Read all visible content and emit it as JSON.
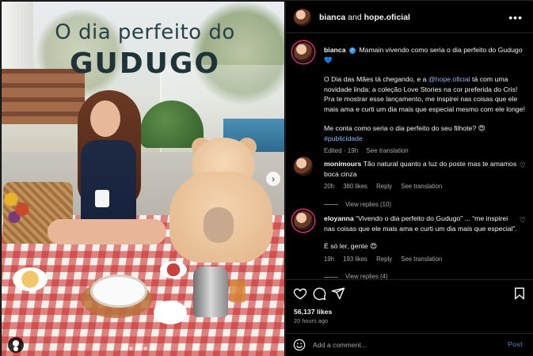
{
  "media": {
    "overlay_title_line1": "O dia perfeito do",
    "overlay_title_line2": "GUDUGO",
    "carousel_dots": 5,
    "active_dot": 0
  },
  "header": {
    "user1": "bianca",
    "and_text": " and ",
    "user2": "hope.oficial",
    "more_icon": "more-horizontal-icon"
  },
  "post": {
    "username": "bianca",
    "verified_icon": "verified-badge-icon",
    "line1": "Mamain vivendo como seria o dia perfeito do Gudugo",
    "heart_emoji": "💙",
    "p2_before": "O Dia das Mães tá chegando, e a ",
    "p2_mention": "@hope.oficial",
    "p2_after": " tá com uma novidade linda: a coleção Love Stories na cor preferida do Cris! Pra te mostrar esse lançamento, me inspirei nas coisas que ele mais ama e curti um dia mais que especial mesmo com ele longe!",
    "p3": "Me conta como seria o dia perfeito do seu filhote? 😍",
    "hashtag": "#publicidade",
    "edited": "Edited · 19h",
    "see_translation": "See translation"
  },
  "comments": [
    {
      "username": "monimours",
      "text": "Tão natural quanto a luz do poste mas te amamos boca cinza",
      "time": "20h",
      "likes": "380 likes",
      "reply": "Reply",
      "translation": "See translation",
      "view_replies": "View replies (10)"
    },
    {
      "username": "eloyanna",
      "text": "“Vivendo o dia perfeito do Gudugo” ... “me inspirei nas coisas que ele mais ama e curti um dia mais que especial”.",
      "text2": "É só ler, gente 😍",
      "time": "19h",
      "likes": "193 likes",
      "reply": "Reply",
      "translation": "See translation",
      "view_replies": "View replies (4)"
    }
  ],
  "actions": {
    "like_icon": "heart-icon",
    "comment_icon": "comment-icon",
    "share_icon": "send-icon",
    "save_icon": "bookmark-icon",
    "likes_count": "56,137 likes",
    "time_ago": "20 hours ago"
  },
  "add_comment": {
    "emoji_icon": "emoji-icon",
    "placeholder": "Add a comment...",
    "post_label": "Post"
  },
  "colors": {
    "background": "#000000",
    "text": "#f5f5f5",
    "muted": "#a8a8a8",
    "link": "#8ab4f8",
    "post_button": "#4a5c8a",
    "story_ring": "#d62976"
  }
}
